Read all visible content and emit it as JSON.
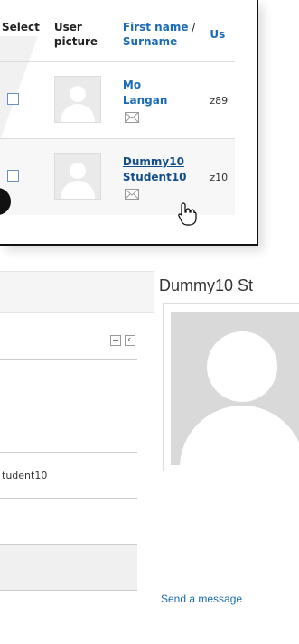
{
  "participants_table": {
    "columns": {
      "select": "Select",
      "user_picture": "User picture",
      "name_first": "First name",
      "name_sep": " / ",
      "name_last": "Surname",
      "userid_truncated": "Us"
    },
    "rows": [
      {
        "first_name": "Mo",
        "surname": "Langan",
        "userid": "z89"
      },
      {
        "first_name": "Dummy10",
        "surname": "Student10",
        "userid": "z10"
      }
    ]
  },
  "profile": {
    "name_truncated": "Dummy10 St",
    "send_message_link": "Send a message"
  },
  "sidebar_block": {
    "rows": [
      "",
      "",
      "tudent10",
      "",
      ""
    ]
  },
  "icons": {
    "message": "envelope-icon",
    "cursor": "hand-pointer-icon"
  },
  "colors": {
    "link": "#1a6bb5",
    "checkbox_border": "#6a8fc1",
    "placeholder_gray": "#d9d9d9"
  }
}
